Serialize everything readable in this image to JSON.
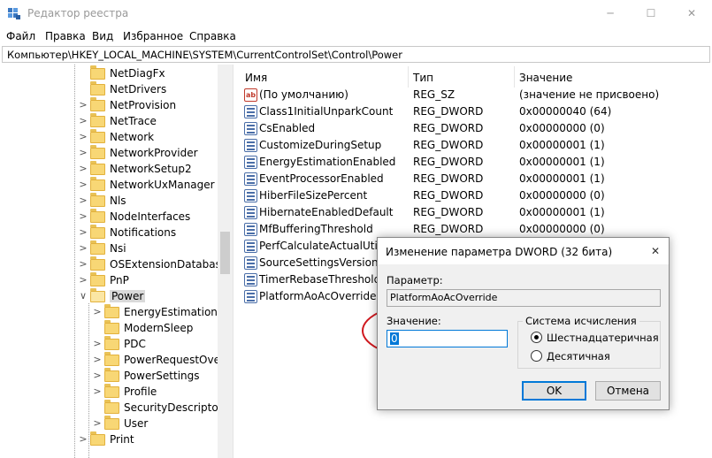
{
  "window": {
    "title": "Редактор реестра",
    "controls": {
      "minimize": "─",
      "maximize": "☐",
      "close": "✕"
    }
  },
  "menu": [
    "Файл",
    "Правка",
    "Вид",
    "Избранное",
    "Справка"
  ],
  "address": "Компьютер\\HKEY_LOCAL_MACHINE\\SYSTEM\\CurrentControlSet\\Control\\Power",
  "tree": {
    "items": [
      {
        "label": "NetDiagFx",
        "level": 1,
        "expander": ""
      },
      {
        "label": "NetDrivers",
        "level": 1,
        "expander": ""
      },
      {
        "label": "NetProvision",
        "level": 1,
        "expander": ">"
      },
      {
        "label": "NetTrace",
        "level": 1,
        "expander": ">"
      },
      {
        "label": "Network",
        "level": 1,
        "expander": ">"
      },
      {
        "label": "NetworkProvider",
        "level": 1,
        "expander": ">"
      },
      {
        "label": "NetworkSetup2",
        "level": 1,
        "expander": ">"
      },
      {
        "label": "NetworkUxManager",
        "level": 1,
        "expander": ">"
      },
      {
        "label": "Nls",
        "level": 1,
        "expander": ">"
      },
      {
        "label": "NodeInterfaces",
        "level": 1,
        "expander": ">"
      },
      {
        "label": "Notifications",
        "level": 1,
        "expander": ">"
      },
      {
        "label": "Nsi",
        "level": 1,
        "expander": ">"
      },
      {
        "label": "OSExtensionDatabase",
        "level": 1,
        "expander": ">"
      },
      {
        "label": "PnP",
        "level": 1,
        "expander": ">"
      },
      {
        "label": "Power",
        "level": 1,
        "expander": "∨",
        "selected": true
      },
      {
        "label": "EnergyEstimation",
        "level": 2,
        "expander": ">"
      },
      {
        "label": "ModernSleep",
        "level": 2,
        "expander": ""
      },
      {
        "label": "PDC",
        "level": 2,
        "expander": ">"
      },
      {
        "label": "PowerRequestOverri",
        "level": 2,
        "expander": ">"
      },
      {
        "label": "PowerSettings",
        "level": 2,
        "expander": ">"
      },
      {
        "label": "Profile",
        "level": 2,
        "expander": ">"
      },
      {
        "label": "SecurityDescriptors",
        "level": 2,
        "expander": ""
      },
      {
        "label": "User",
        "level": 2,
        "expander": ">"
      },
      {
        "label": "Print",
        "level": 1,
        "expander": ">"
      }
    ]
  },
  "list": {
    "columns": {
      "name": "Имя",
      "type": "Тип",
      "value": "Значение"
    },
    "rows": [
      {
        "icon": "string-value-icon",
        "name": "(По умолчанию)",
        "type": "REG_SZ",
        "value": "(значение не присвоено)"
      },
      {
        "icon": "binary-value-icon",
        "name": "Class1InitialUnparkCount",
        "type": "REG_DWORD",
        "value": "0x00000040 (64)"
      },
      {
        "icon": "binary-value-icon",
        "name": "CsEnabled",
        "type": "REG_DWORD",
        "value": "0x00000000 (0)"
      },
      {
        "icon": "binary-value-icon",
        "name": "CustomizeDuringSetup",
        "type": "REG_DWORD",
        "value": "0x00000001 (1)"
      },
      {
        "icon": "binary-value-icon",
        "name": "EnergyEstimationEnabled",
        "type": "REG_DWORD",
        "value": "0x00000001 (1)"
      },
      {
        "icon": "binary-value-icon",
        "name": "EventProcessorEnabled",
        "type": "REG_DWORD",
        "value": "0x00000001 (1)"
      },
      {
        "icon": "binary-value-icon",
        "name": "HiberFileSizePercent",
        "type": "REG_DWORD",
        "value": "0x00000000 (0)"
      },
      {
        "icon": "binary-value-icon",
        "name": "HibernateEnabledDefault",
        "type": "REG_DWORD",
        "value": "0x00000001 (1)"
      },
      {
        "icon": "binary-value-icon",
        "name": "MfBufferingThreshold",
        "type": "REG_DWORD",
        "value": "0x00000000 (0)"
      },
      {
        "icon": "binary-value-icon",
        "name": "PerfCalculateActualUtiliza",
        "type": "",
        "value": ""
      },
      {
        "icon": "binary-value-icon",
        "name": "SourceSettingsVersion",
        "type": "",
        "value": ""
      },
      {
        "icon": "binary-value-icon",
        "name": "TimerRebaseThresholdOn",
        "type": "",
        "value": ""
      },
      {
        "icon": "binary-value-icon",
        "name": "PlatformAoAcOverride",
        "type": "",
        "value": ""
      }
    ]
  },
  "dialog": {
    "title": "Изменение параметра DWORD (32 бита)",
    "close": "✕",
    "param_label": "Параметр:",
    "param_value": "PlatformAoAcOverride",
    "value_label": "Значение:",
    "value": "0",
    "base_group_title": "Система исчисления",
    "radio_hex": "Шестнадцатеричная",
    "radio_dec": "Десятичная",
    "selected_base": "hex",
    "ok": "OK",
    "cancel": "Отмена"
  },
  "colors": {
    "annotation": "#d0191f",
    "accent": "#0078d7",
    "folder": "#f8d775"
  }
}
